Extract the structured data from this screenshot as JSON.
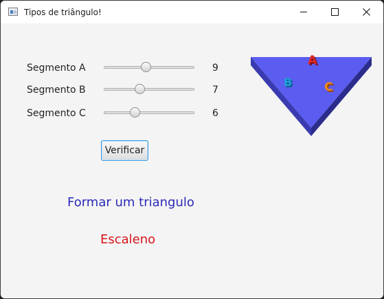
{
  "window": {
    "title": "Tipos de triângulo!"
  },
  "sliders": [
    {
      "label": "Segmento A",
      "value": "9",
      "level": 0.46
    },
    {
      "label": "Segmento B",
      "value": "7",
      "level": 0.38
    },
    {
      "label": "Segmento C",
      "value": "6",
      "level": 0.32
    }
  ],
  "actions": {
    "verify_label": "Verificar"
  },
  "result": {
    "message": "Formar um triangulo",
    "type": "Escaleno"
  },
  "image": {
    "letters": [
      "A",
      "B",
      "C"
    ]
  },
  "colors": {
    "accent": "#3d9be0",
    "message": "#2a2ab8",
    "type": "#d6151b",
    "triangle_top": "#5b5cf0"
  }
}
